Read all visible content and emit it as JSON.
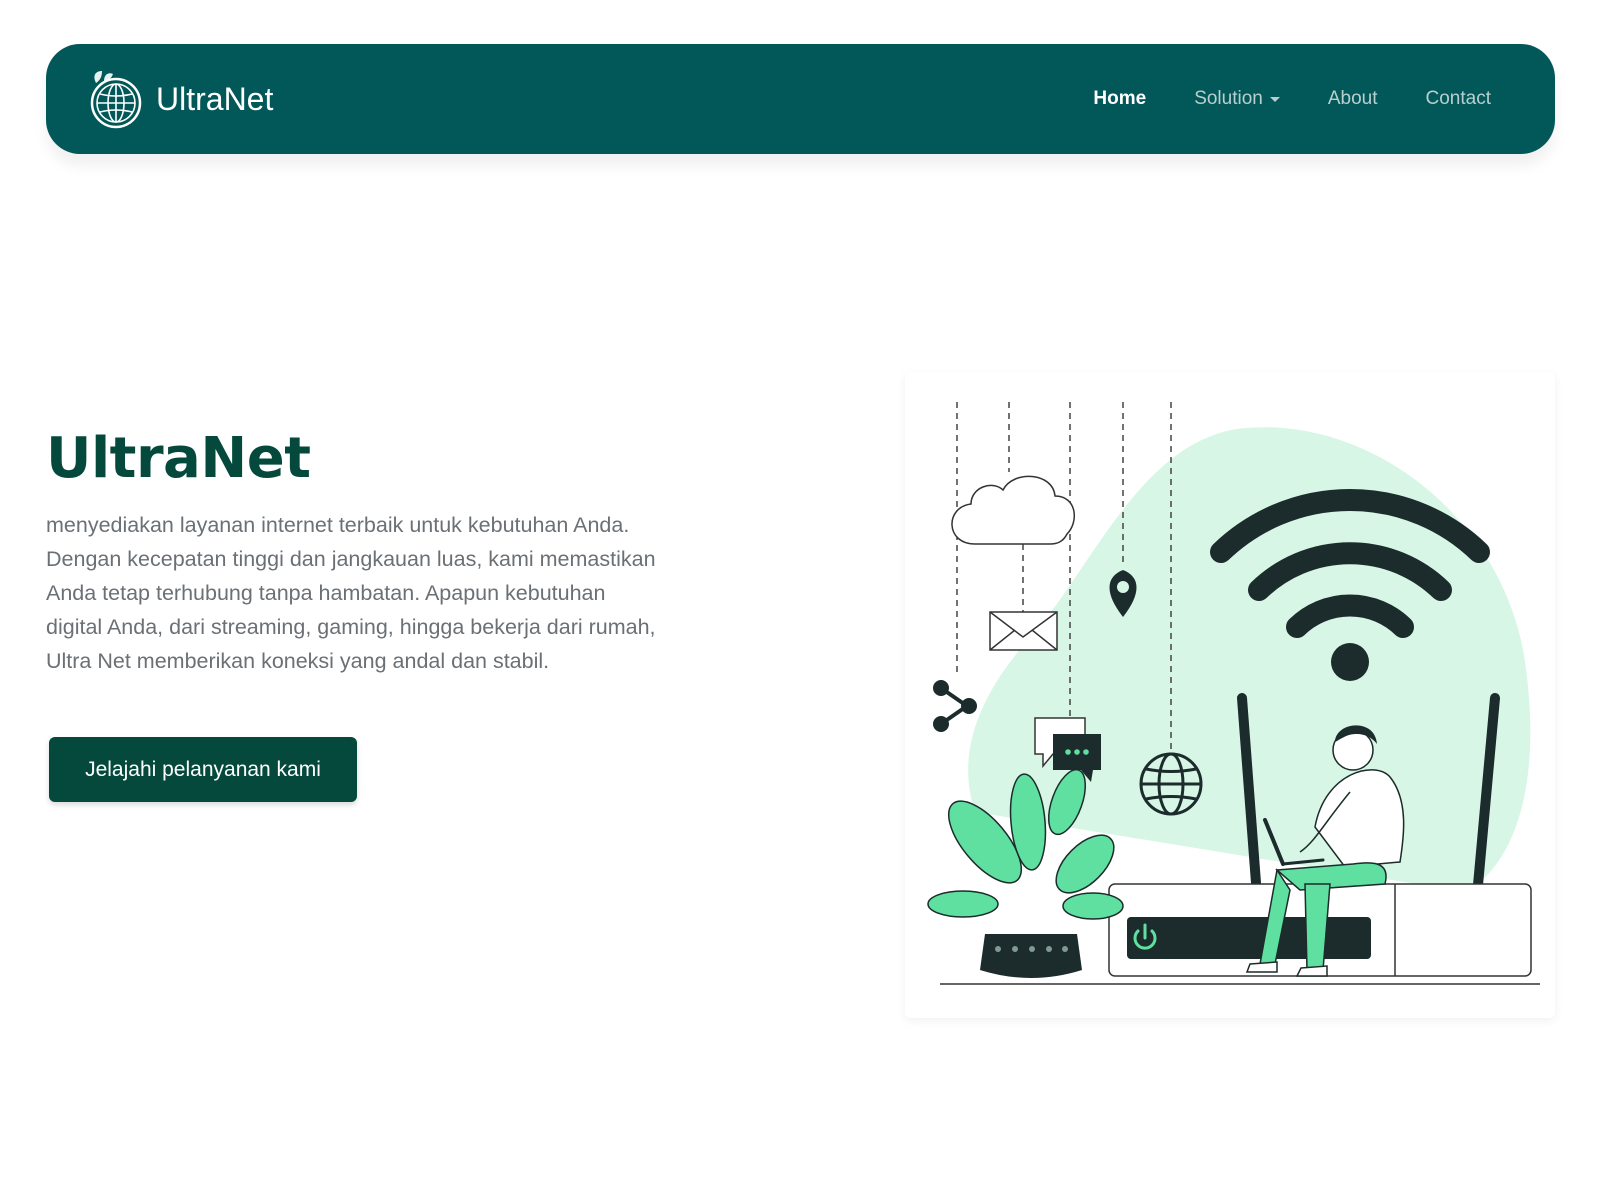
{
  "navbar": {
    "brand": "UltraNet",
    "links": [
      {
        "label": "Home",
        "active": true
      },
      {
        "label": "Solution",
        "dropdown": true
      },
      {
        "label": "About"
      },
      {
        "label": "Contact"
      }
    ]
  },
  "hero": {
    "title": "UltraNet",
    "description": "menyediakan layanan internet terbaik untuk kebutuhan Anda. Dengan kecepatan tinggi dan jangkauan luas, kami memastikan Anda tetap terhubung tanpa hambatan. Apapun kebutuhan digital Anda, dari streaming, gaming, hingga bekerja dari rumah, Ultra Net memberikan koneksi yang andal dan stabil.",
    "cta_label": "Jelajahi pelanyanan kami"
  },
  "colors": {
    "navbar_bg": "#025859",
    "primary": "#05493d",
    "accent": "#5fe0a0",
    "blob": "#d7f6e6",
    "dark": "#1c2b2b"
  },
  "illustration_icons": [
    "cloud-icon",
    "envelope-icon",
    "map-pin-icon",
    "share-icon",
    "chat-icon",
    "globe-icon",
    "wifi-icon",
    "power-icon"
  ]
}
